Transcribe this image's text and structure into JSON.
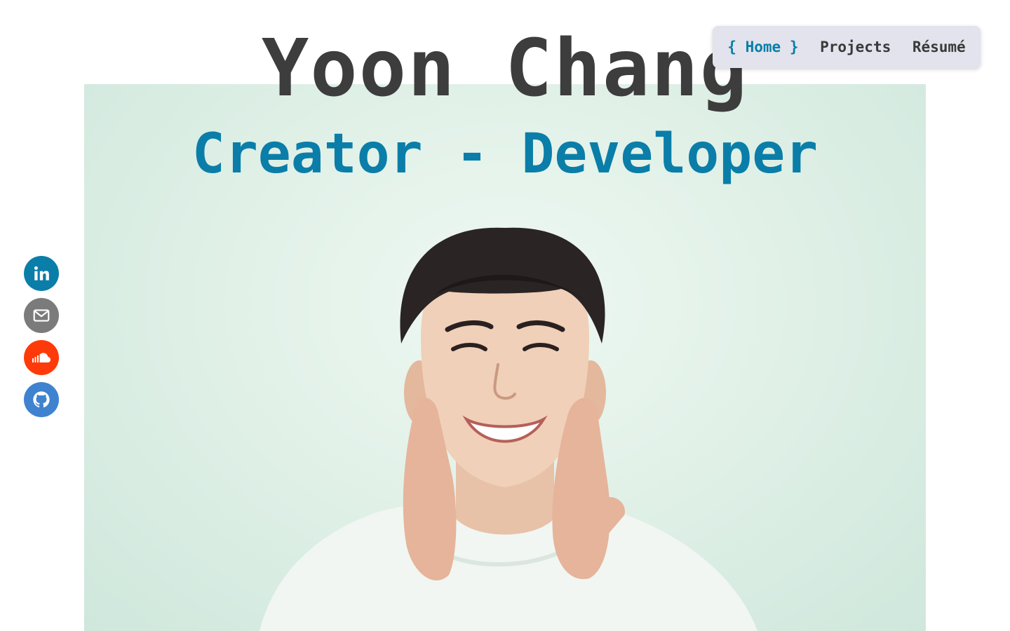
{
  "header": {
    "name": "Yoon Chang",
    "tagline": "Creator - Developer"
  },
  "nav": {
    "items": [
      {
        "label": "Home",
        "active": true,
        "open_brace": "{",
        "close_brace": "}"
      },
      {
        "label": "Projects",
        "active": false
      },
      {
        "label": "Résumé",
        "active": false
      }
    ]
  },
  "social": [
    {
      "icon": "linkedin-icon",
      "color": "#0a7ea8"
    },
    {
      "icon": "mail-icon",
      "color": "#7b7b7b"
    },
    {
      "icon": "soundcloud-icon",
      "color": "#ff3a0a"
    },
    {
      "icon": "github-icon",
      "color": "#3f82d0"
    }
  ],
  "colors": {
    "accent": "#0a7ea8",
    "title": "#3d3d3d",
    "nav_bg": "#e2e3ec",
    "hero_bg": "#e1f1e8"
  }
}
